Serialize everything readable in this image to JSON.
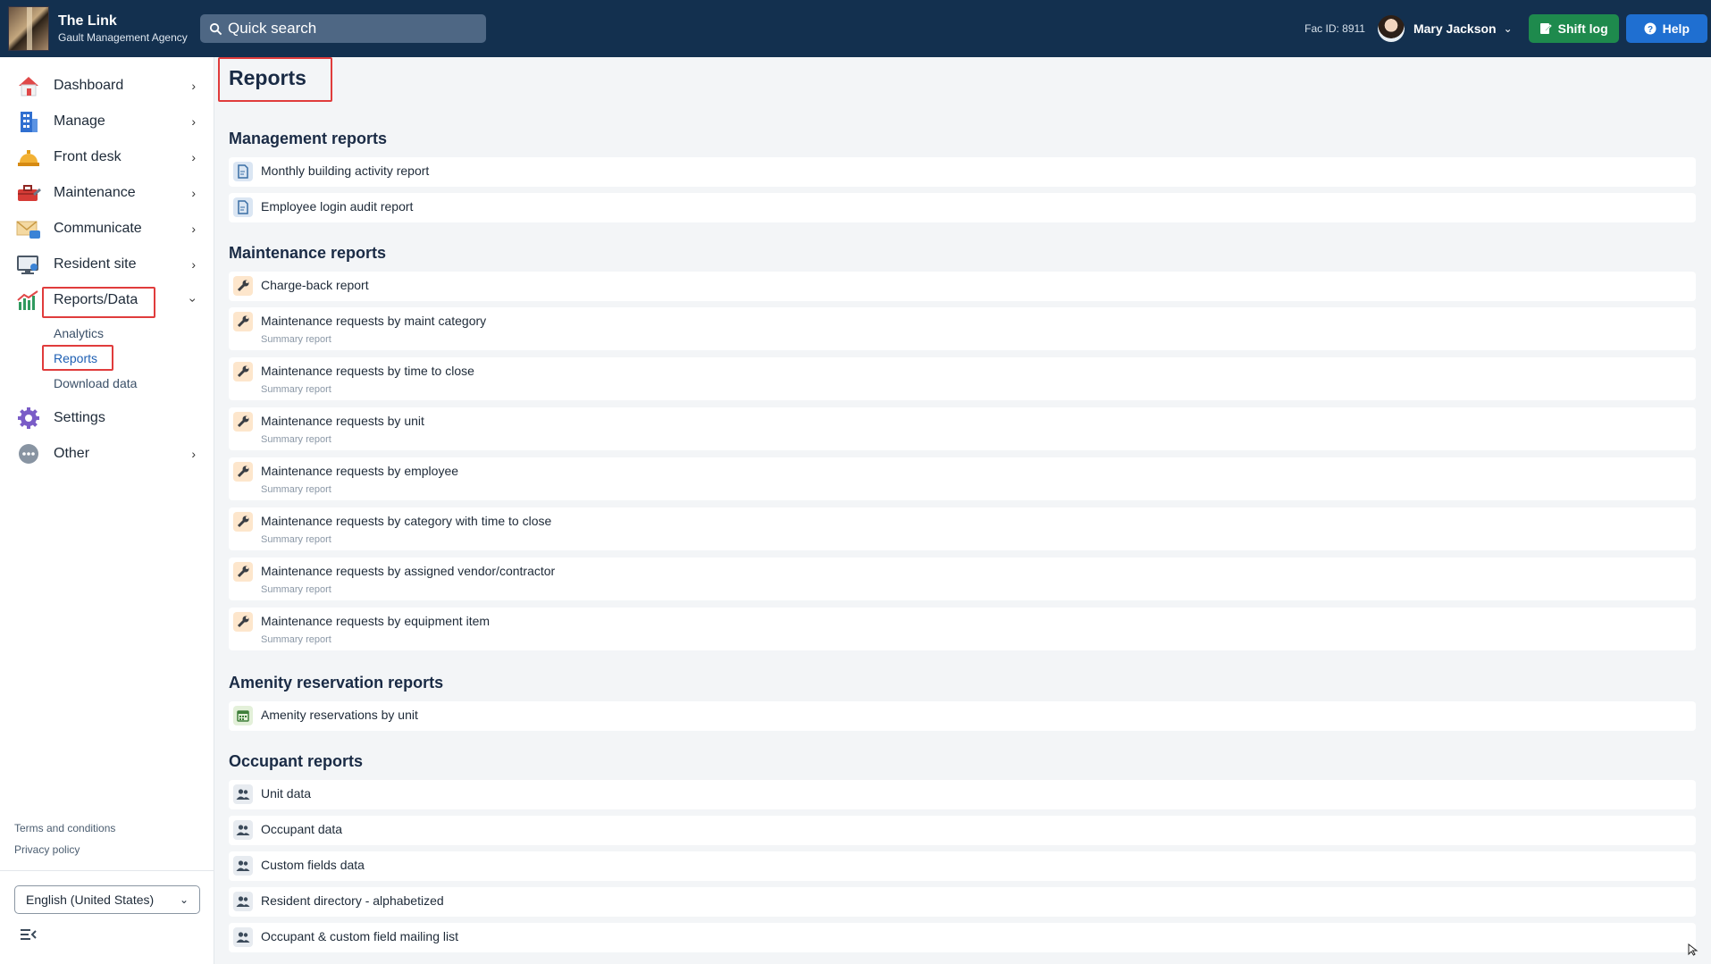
{
  "header": {
    "brand_title": "The Link",
    "brand_subtitle": "Gault Management Agency",
    "search_placeholder": "Quick search",
    "fac_id": "Fac ID: 8911",
    "user_name": "Mary Jackson",
    "shift_log": "Shift log",
    "help": "Help"
  },
  "sidebar": {
    "items": [
      {
        "label": "Dashboard",
        "icon": "house-icon"
      },
      {
        "label": "Manage",
        "icon": "building-icon"
      },
      {
        "label": "Front desk",
        "icon": "desk-bell-icon"
      },
      {
        "label": "Maintenance",
        "icon": "toolbox-icon"
      },
      {
        "label": "Communicate",
        "icon": "envelope-icon"
      },
      {
        "label": "Resident site",
        "icon": "monitor-icon"
      },
      {
        "label": "Reports/Data",
        "icon": "chart-icon"
      },
      {
        "label": "Settings",
        "icon": "gear-icon"
      },
      {
        "label": "Other",
        "icon": "more-icon"
      }
    ],
    "reports_sub": [
      "Analytics",
      "Reports",
      "Download data"
    ],
    "footer": {
      "terms": "Terms and conditions",
      "privacy": "Privacy policy"
    },
    "language": "English (United States)"
  },
  "main": {
    "title": "Reports",
    "sections": [
      {
        "title": "Management reports",
        "items": [
          {
            "label": "Monthly building activity report"
          },
          {
            "label": "Employee login audit report"
          }
        ]
      },
      {
        "title": "Maintenance reports",
        "items": [
          {
            "label": "Charge-back report"
          },
          {
            "label": "Maintenance requests by maint category",
            "sub": "Summary report"
          },
          {
            "label": "Maintenance requests by time to close",
            "sub": "Summary report"
          },
          {
            "label": "Maintenance requests by unit",
            "sub": "Summary report"
          },
          {
            "label": "Maintenance requests by employee",
            "sub": "Summary report"
          },
          {
            "label": "Maintenance requests by category with time to close",
            "sub": "Summary report"
          },
          {
            "label": "Maintenance requests by assigned vendor/contractor",
            "sub": "Summary report"
          },
          {
            "label": "Maintenance requests by equipment item",
            "sub": "Summary report"
          }
        ]
      },
      {
        "title": "Amenity reservation reports",
        "items": [
          {
            "label": "Amenity reservations by unit"
          }
        ]
      },
      {
        "title": "Occupant reports",
        "items": [
          {
            "label": "Unit data"
          },
          {
            "label": "Occupant data"
          },
          {
            "label": "Custom fields data"
          },
          {
            "label": "Resident directory - alphabetized"
          },
          {
            "label": "Occupant & custom field mailing list"
          }
        ]
      }
    ]
  }
}
